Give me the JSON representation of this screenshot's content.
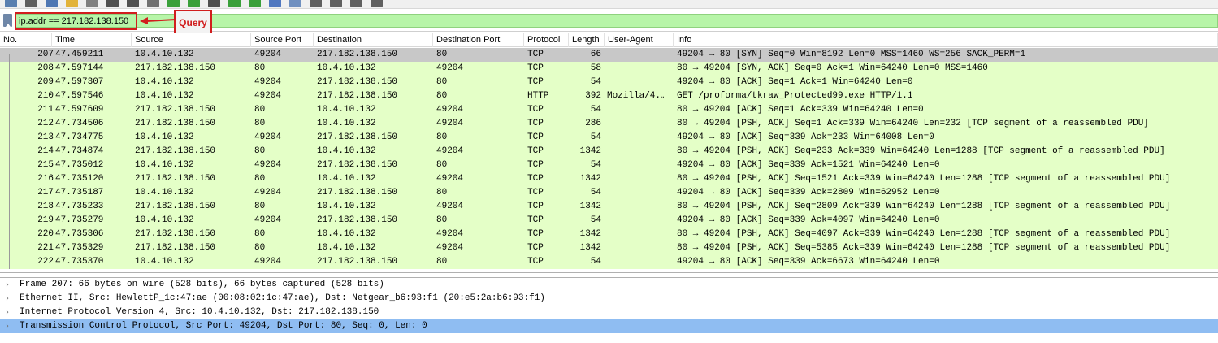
{
  "filter": {
    "value": "ip.addr == 217.182.138.150",
    "placeholder": ""
  },
  "annotation": {
    "label": "Query"
  },
  "colors": {
    "filter_bg": "#b7f5a8",
    "row_bg": "#e4ffc7",
    "selected_row_bg": "#c8c8c8",
    "selected_detail_bg": "#8fbdf2",
    "annotation_red": "#d11e1e"
  },
  "columns": [
    "No.",
    "Time",
    "Source",
    "Source Port",
    "Destination",
    "Destination Port",
    "Protocol",
    "Length",
    "User-Agent",
    "Info"
  ],
  "packets": [
    {
      "no": "207",
      "time": "47.459211",
      "source": "10.4.10.132",
      "sport": "49204",
      "destination": "217.182.138.150",
      "dport": "80",
      "protocol": "TCP",
      "length": "66",
      "ua": "",
      "info": "49204 → 80 [SYN] Seq=0 Win=8192 Len=0 MSS=1460 WS=256 SACK_PERM=1"
    },
    {
      "no": "208",
      "time": "47.597144",
      "source": "217.182.138.150",
      "sport": "80",
      "destination": "10.4.10.132",
      "dport": "49204",
      "protocol": "TCP",
      "length": "58",
      "ua": "",
      "info": "80 → 49204 [SYN, ACK] Seq=0 Ack=1 Win=64240 Len=0 MSS=1460"
    },
    {
      "no": "209",
      "time": "47.597307",
      "source": "10.4.10.132",
      "sport": "49204",
      "destination": "217.182.138.150",
      "dport": "80",
      "protocol": "TCP",
      "length": "54",
      "ua": "",
      "info": "49204 → 80 [ACK] Seq=1 Ack=1 Win=64240 Len=0"
    },
    {
      "no": "210",
      "time": "47.597546",
      "source": "10.4.10.132",
      "sport": "49204",
      "destination": "217.182.138.150",
      "dport": "80",
      "protocol": "HTTP",
      "length": "392",
      "ua": "Mozilla/4.…",
      "info": "GET /proforma/tkraw_Protected99.exe HTTP/1.1"
    },
    {
      "no": "211",
      "time": "47.597609",
      "source": "217.182.138.150",
      "sport": "80",
      "destination": "10.4.10.132",
      "dport": "49204",
      "protocol": "TCP",
      "length": "54",
      "ua": "",
      "info": "80 → 49204 [ACK] Seq=1 Ack=339 Win=64240 Len=0"
    },
    {
      "no": "212",
      "time": "47.734506",
      "source": "217.182.138.150",
      "sport": "80",
      "destination": "10.4.10.132",
      "dport": "49204",
      "protocol": "TCP",
      "length": "286",
      "ua": "",
      "info": "80 → 49204 [PSH, ACK] Seq=1 Ack=339 Win=64240 Len=232 [TCP segment of a reassembled PDU]"
    },
    {
      "no": "213",
      "time": "47.734775",
      "source": "10.4.10.132",
      "sport": "49204",
      "destination": "217.182.138.150",
      "dport": "80",
      "protocol": "TCP",
      "length": "54",
      "ua": "",
      "info": "49204 → 80 [ACK] Seq=339 Ack=233 Win=64008 Len=0"
    },
    {
      "no": "214",
      "time": "47.734874",
      "source": "217.182.138.150",
      "sport": "80",
      "destination": "10.4.10.132",
      "dport": "49204",
      "protocol": "TCP",
      "length": "1342",
      "ua": "",
      "info": "80 → 49204 [PSH, ACK] Seq=233 Ack=339 Win=64240 Len=1288 [TCP segment of a reassembled PDU]"
    },
    {
      "no": "215",
      "time": "47.735012",
      "source": "10.4.10.132",
      "sport": "49204",
      "destination": "217.182.138.150",
      "dport": "80",
      "protocol": "TCP",
      "length": "54",
      "ua": "",
      "info": "49204 → 80 [ACK] Seq=339 Ack=1521 Win=64240 Len=0"
    },
    {
      "no": "216",
      "time": "47.735120",
      "source": "217.182.138.150",
      "sport": "80",
      "destination": "10.4.10.132",
      "dport": "49204",
      "protocol": "TCP",
      "length": "1342",
      "ua": "",
      "info": "80 → 49204 [PSH, ACK] Seq=1521 Ack=339 Win=64240 Len=1288 [TCP segment of a reassembled PDU]"
    },
    {
      "no": "217",
      "time": "47.735187",
      "source": "10.4.10.132",
      "sport": "49204",
      "destination": "217.182.138.150",
      "dport": "80",
      "protocol": "TCP",
      "length": "54",
      "ua": "",
      "info": "49204 → 80 [ACK] Seq=339 Ack=2809 Win=62952 Len=0"
    },
    {
      "no": "218",
      "time": "47.735233",
      "source": "217.182.138.150",
      "sport": "80",
      "destination": "10.4.10.132",
      "dport": "49204",
      "protocol": "TCP",
      "length": "1342",
      "ua": "",
      "info": "80 → 49204 [PSH, ACK] Seq=2809 Ack=339 Win=64240 Len=1288 [TCP segment of a reassembled PDU]"
    },
    {
      "no": "219",
      "time": "47.735279",
      "source": "10.4.10.132",
      "sport": "49204",
      "destination": "217.182.138.150",
      "dport": "80",
      "protocol": "TCP",
      "length": "54",
      "ua": "",
      "info": "49204 → 80 [ACK] Seq=339 Ack=4097 Win=64240 Len=0"
    },
    {
      "no": "220",
      "time": "47.735306",
      "source": "217.182.138.150",
      "sport": "80",
      "destination": "10.4.10.132",
      "dport": "49204",
      "protocol": "TCP",
      "length": "1342",
      "ua": "",
      "info": "80 → 49204 [PSH, ACK] Seq=4097 Ack=339 Win=64240 Len=1288 [TCP segment of a reassembled PDU]"
    },
    {
      "no": "221",
      "time": "47.735329",
      "source": "217.182.138.150",
      "sport": "80",
      "destination": "10.4.10.132",
      "dport": "49204",
      "protocol": "TCP",
      "length": "1342",
      "ua": "",
      "info": "80 → 49204 [PSH, ACK] Seq=5385 Ack=339 Win=64240 Len=1288 [TCP segment of a reassembled PDU]"
    },
    {
      "no": "222",
      "time": "47.735370",
      "source": "10.4.10.132",
      "sport": "49204",
      "destination": "217.182.138.150",
      "dport": "80",
      "protocol": "TCP",
      "length": "54",
      "ua": "",
      "info": "49204 → 80 [ACK] Seq=339 Ack=6673 Win=64240 Len=0"
    }
  ],
  "selected_packet": "207",
  "details": [
    {
      "text": "Frame 207: 66 bytes on wire (528 bits), 66 bytes captured (528 bits)",
      "selected": false
    },
    {
      "text": "Ethernet II, Src: HewlettP_1c:47:ae (00:08:02:1c:47:ae), Dst: Netgear_b6:93:f1 (20:e5:2a:b6:93:f1)",
      "selected": false
    },
    {
      "text": "Internet Protocol Version 4, Src: 10.4.10.132, Dst: 217.182.138.150",
      "selected": false
    },
    {
      "text": "Transmission Control Protocol, Src Port: 49204, Dst Port: 80, Seq: 0, Len: 0",
      "selected": true
    }
  ],
  "toolbar_icons": [
    "save-icon",
    "close-file-icon",
    "reload-icon",
    "open-icon",
    "binary-icon",
    "export-icon",
    "print-icon",
    "find-icon",
    "back-icon",
    "forward-icon",
    "go-to-icon",
    "first-icon",
    "last-icon",
    "autoscroll-icon",
    "colorize-icon",
    "zoom-in-icon",
    "zoom-out-icon",
    "zoom-reset-icon",
    "resize-columns-icon"
  ]
}
